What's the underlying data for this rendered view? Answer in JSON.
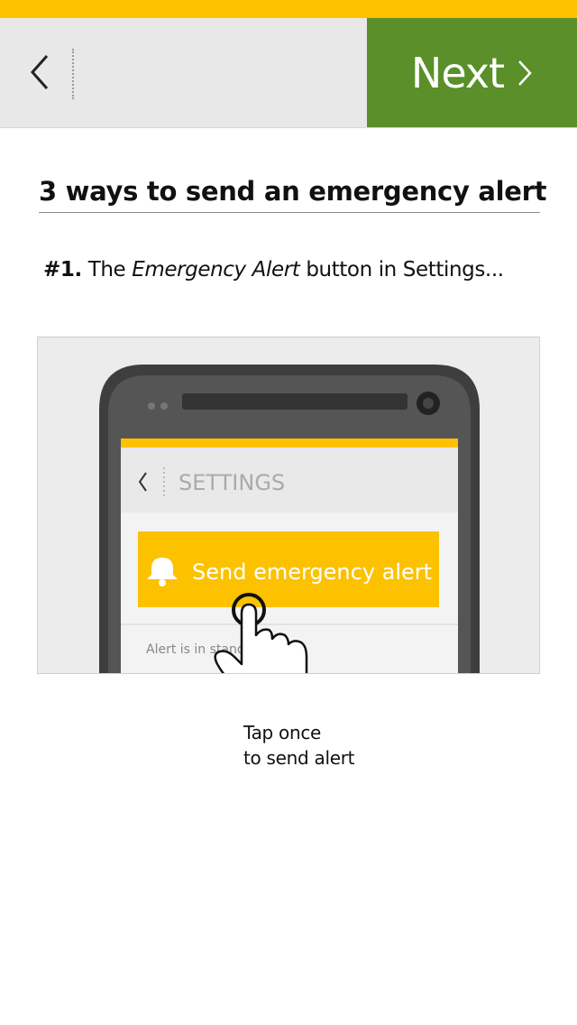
{
  "header": {
    "back_icon": "chevron-left-icon",
    "next_label": "Next",
    "next_icon": "chevron-right-icon",
    "accent_color": "#fcc200",
    "next_color": "#5a8f29"
  },
  "content": {
    "title": "3 ways to send an emergency alert",
    "step_number": "#1.",
    "step_text_before": " The ",
    "step_emphasis": "Emergency Alert",
    "step_text_after": " button in Settings..."
  },
  "illustration": {
    "screen_title": "SETTINGS",
    "button_label": "Send emergency alert",
    "button_icon": "bell-icon",
    "status_text": "Alert is in stand",
    "hand_icon": "tap-hand-icon"
  },
  "caption": {
    "line1": "Tap once",
    "line2": "to send alert"
  }
}
